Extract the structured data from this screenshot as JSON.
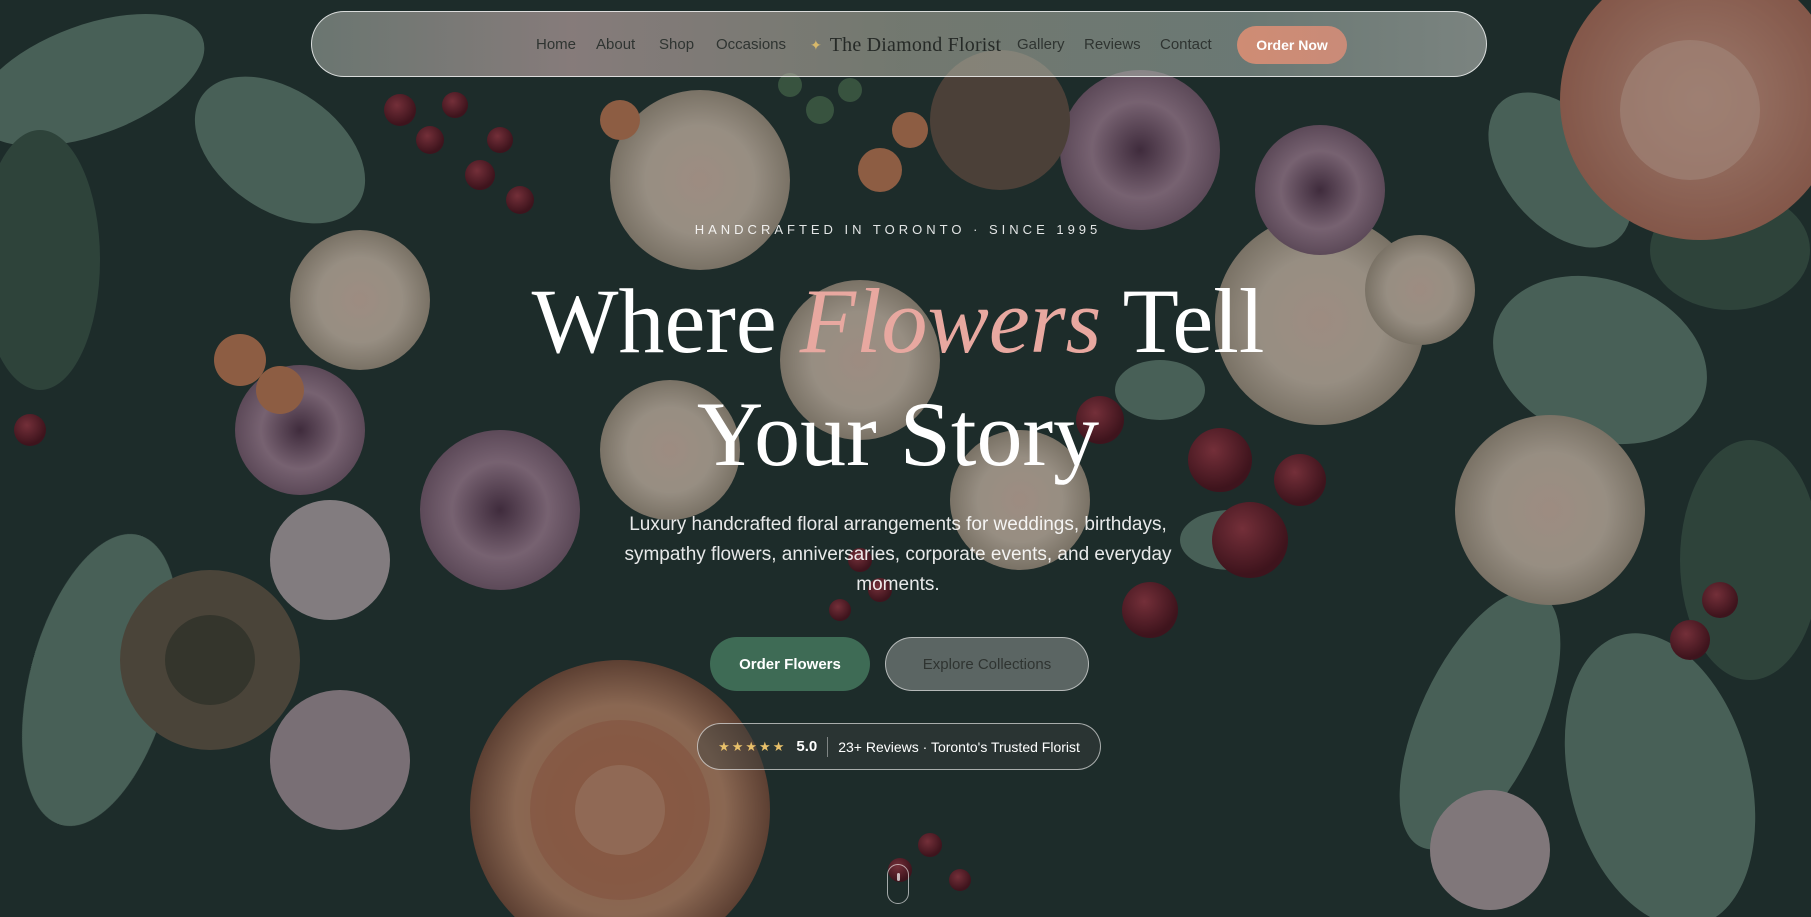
{
  "nav": {
    "left_links": [
      "Home",
      "About",
      "Shop",
      "Occasions"
    ],
    "brand": "The Diamond Florist",
    "right_links": [
      "Gallery",
      "Reviews",
      "Contact"
    ],
    "cta": "Order Now"
  },
  "hero": {
    "eyebrow": "HANDCRAFTED IN TORONTO · SINCE 1995",
    "headline_part1": "Where",
    "headline_accent": "Flowers",
    "headline_part2": "Tell",
    "headline_line2": "Your Story",
    "subtitle": "Luxury handcrafted floral arrangements for weddings, birthdays, sympathy flowers, anniversaries, corporate events, and everyday moments.",
    "primary_button": "Order Flowers",
    "secondary_button": "Explore Collections"
  },
  "rating": {
    "stars": "★★★★★",
    "score": "5.0",
    "reviews": "23+ Reviews · Toronto's Trusted Florist"
  },
  "colors": {
    "accent_pink": "#e8a8a0",
    "primary_green": "#3e6b55",
    "cta_coral": "#cf8c74"
  }
}
